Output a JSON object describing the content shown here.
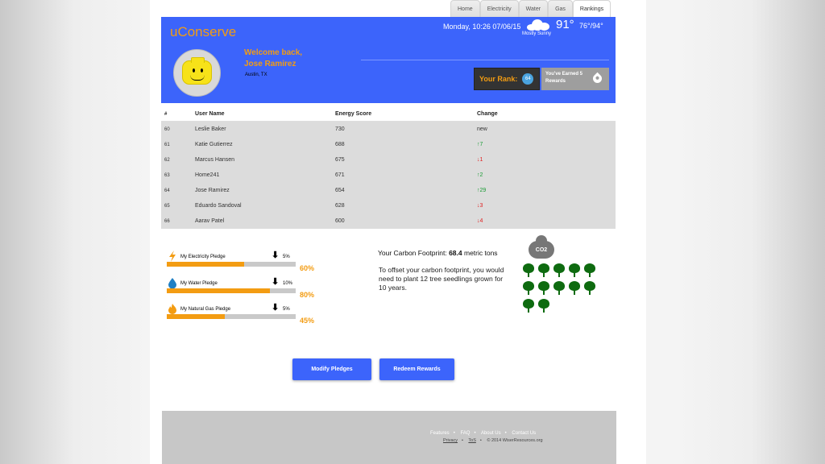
{
  "nav": {
    "tabs": [
      "Home",
      "Electricity",
      "Water",
      "Gas",
      "Rankings"
    ]
  },
  "header": {
    "logo": "uConserve",
    "welcome_line1": "Welcome back,",
    "welcome_line2": "Jose Ramirez",
    "location": "Austin, TX",
    "datetime": "Monday, 10:26 07/06/15",
    "weather_desc": "Mostly Sunny",
    "temperature": "91°",
    "temp_range": "76°/94°",
    "rank_label": "Your Rank:",
    "rank_value": "64",
    "rewards_line1": "You've Earned 5",
    "rewards_line2": "Rewards"
  },
  "table": {
    "headers": [
      "#",
      "User Name",
      "Energy Score",
      "Change"
    ],
    "rows": [
      {
        "rank": "60",
        "name": "Leslie Baker",
        "score": "730",
        "change": "new",
        "dir": "none"
      },
      {
        "rank": "61",
        "name": "Katie Gutierrez",
        "score": "688",
        "change": "↑7",
        "dir": "up"
      },
      {
        "rank": "62",
        "name": "Marcus Hansen",
        "score": "675",
        "change": "↓1",
        "dir": "down"
      },
      {
        "rank": "63",
        "name": "Home241",
        "score": "671",
        "change": "↑2",
        "dir": "up"
      },
      {
        "rank": "64",
        "name": "Jose Ramirez",
        "score": "654",
        "change": "↑29",
        "dir": "up"
      },
      {
        "rank": "65",
        "name": "Eduardo Sandoval",
        "score": "628",
        "change": "↓3",
        "dir": "down"
      },
      {
        "rank": "66",
        "name": "Aarav Patel",
        "score": "600",
        "change": "↓4",
        "dir": "down"
      }
    ]
  },
  "pledges": [
    {
      "label": "My Electricity Pledge",
      "target": "5%",
      "progress_text": "60%",
      "progress": 0.6,
      "arrow": "🠗"
    },
    {
      "label": "My Water Pledge",
      "target": "10%",
      "progress_text": "80%",
      "progress": 0.8,
      "arrow": "🠗"
    },
    {
      "label": "My Natural Gas Pledge",
      "target": "5%",
      "progress_text": "45%",
      "progress": 0.45,
      "arrow": "🠗"
    }
  ],
  "carbon": {
    "title_prefix": "Your Carbon Footprint:",
    "value": "68.4",
    "unit": "metric tons",
    "text": "To offset your carbon footprint, you would need to plant 12 tree seedlings grown for 10 years.",
    "badge": "CO2",
    "tree_count": 12
  },
  "buttons": {
    "modify": "Modify Pledges",
    "redeem": "Redeem Rewards"
  },
  "footer": {
    "links": [
      "Features",
      "FAQ",
      "About Us",
      "Contact Us"
    ],
    "privacy": "Privacy",
    "tos": "ToS",
    "copyright": "© 2014 WiserResources.org"
  },
  "colors": {
    "brand_blue": "#3c64fb",
    "accent_orange": "#f39c12",
    "tree_green": "#0e6b10"
  }
}
